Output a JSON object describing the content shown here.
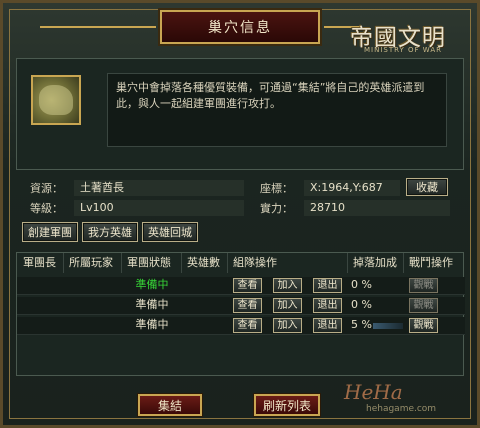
{
  "window": {
    "title": "巢穴信息"
  },
  "logo": {
    "main": "帝國文明",
    "sub": "MINISTRY OF WAR"
  },
  "description": "巢穴中會掉落各種優質裝備，可通過“集結”將自己的英雄派遣到此，與人一起組建軍團進行攻打。",
  "info": {
    "resource_label": "資源：",
    "resource_value": "土著酋長",
    "coord_label": "座標：",
    "coord_value": "X:1964,Y:687",
    "favorite_button": "收藏",
    "level_label": "等級：",
    "level_value": "Lv100",
    "strength_label": "實力：",
    "strength_value": "28710"
  },
  "actions": {
    "create": "創建軍團",
    "my_heroes": "我方英雄",
    "recall": "英雄回城"
  },
  "table": {
    "headers": [
      "軍團長",
      "所屬玩家",
      "軍團狀態",
      "英雄數",
      "組隊操作",
      "掉落加成",
      "戰鬥操作"
    ],
    "rows": [
      {
        "status": "準備中",
        "drop": "0 %",
        "view": "查看",
        "join": "加入",
        "exit": "退出",
        "watch": "觀戰"
      },
      {
        "status": "準備中",
        "drop": "0 %",
        "view": "查看",
        "join": "加入",
        "exit": "退出",
        "watch": "觀戰"
      },
      {
        "status": "準備中",
        "drop": "5 %",
        "view": "查看",
        "join": "加入",
        "exit": "退出",
        "watch": "觀戰"
      }
    ]
  },
  "footer": {
    "rally": "集結",
    "refresh": "刷新列表"
  },
  "watermark": {
    "brand": "HeHa",
    "url": "hehagame.com"
  },
  "colors": {
    "status_active": "#37d437",
    "accent_gold": "#c9a652",
    "title_red": "#4b1410"
  }
}
